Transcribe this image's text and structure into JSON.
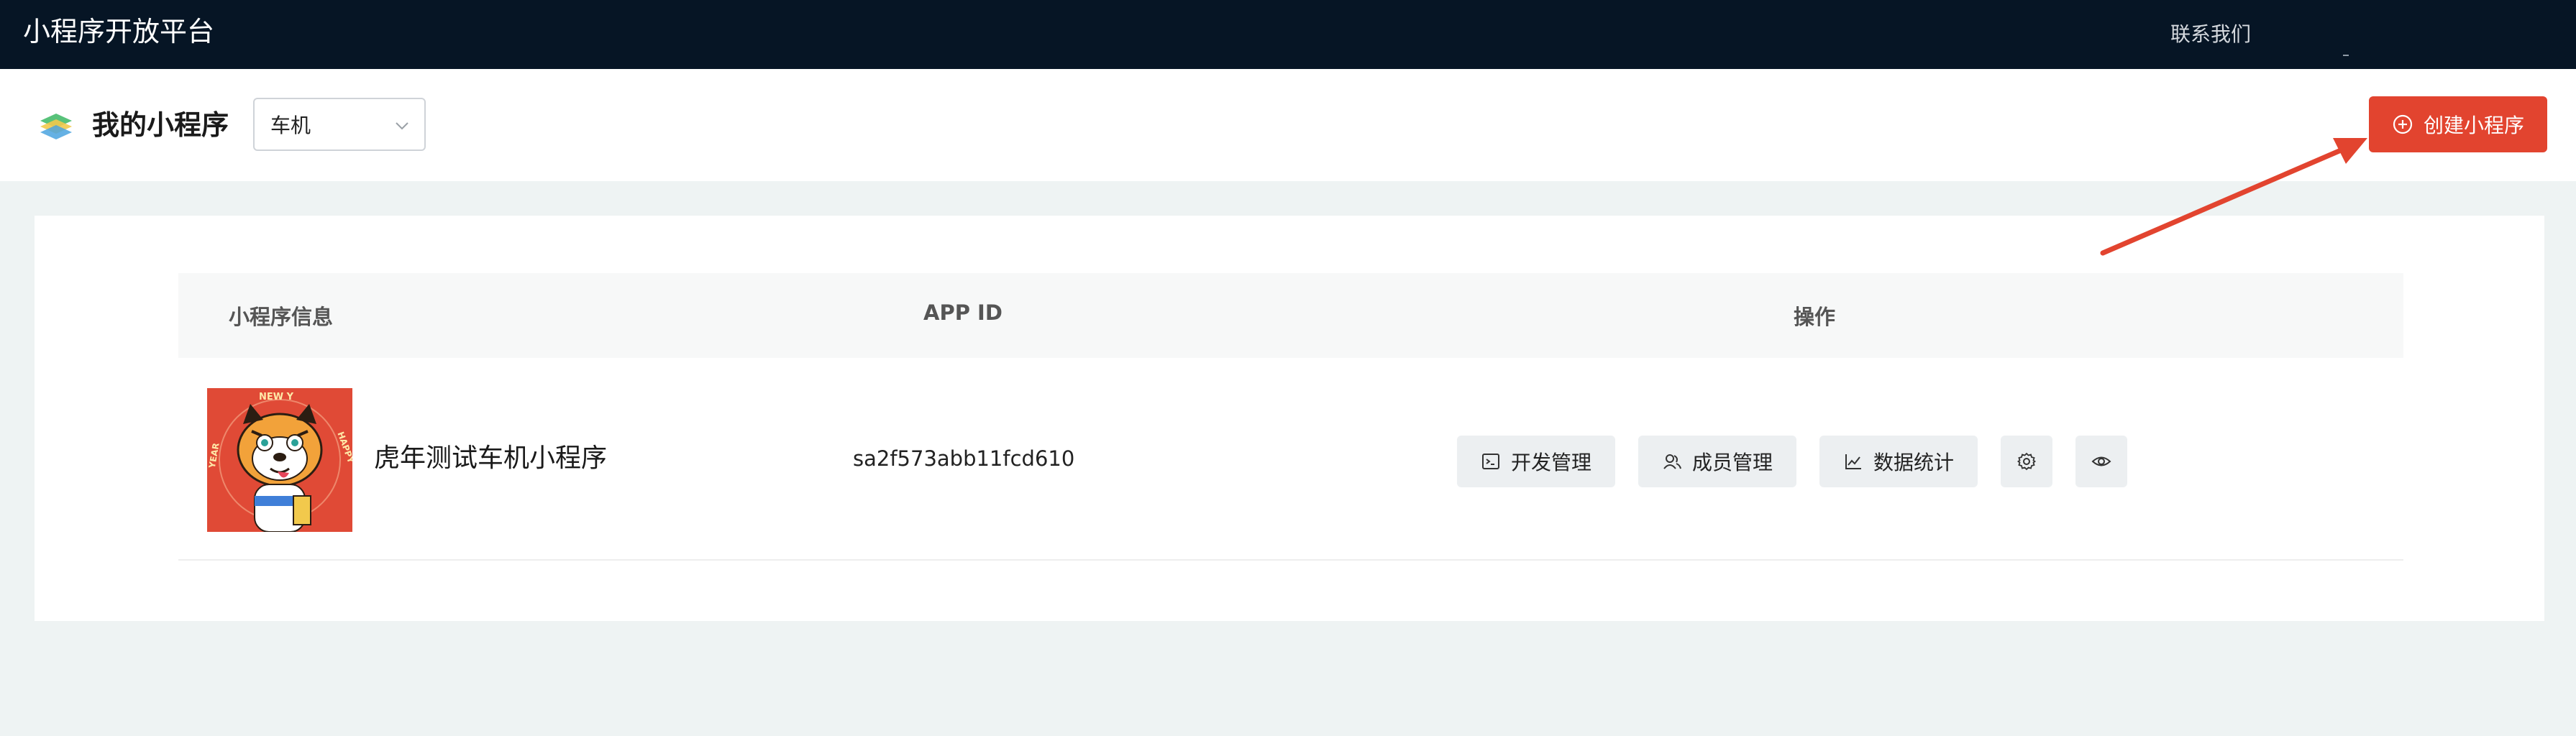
{
  "topbar": {
    "brand": "小程序开放平台",
    "contact": "联系我们"
  },
  "header": {
    "title": "我的小程序",
    "select_value": "车机",
    "create_button": "创建小程序"
  },
  "table": {
    "columns": [
      "小程序信息",
      "APP ID",
      "操作"
    ],
    "rows": [
      {
        "name": "虎年测试车机小程序",
        "app_id": "sa2f573abb11fcd610",
        "actions": {
          "dev": "开发管理",
          "member": "成员管理",
          "stats": "数据统计"
        }
      }
    ]
  },
  "thumbnail_text": {
    "arc_top": "NEW Y",
    "arc_left": "YEAR",
    "arc_right": "HAPPY"
  },
  "colors": {
    "topbar_bg": "#061525",
    "accent_red": "#e2442f",
    "page_bg": "#eef3f3"
  },
  "icons": [
    "logo-icon",
    "chevron-down-icon",
    "plus-circle-icon",
    "terminal-icon",
    "members-icon",
    "chart-line-icon",
    "gear-icon",
    "eye-icon"
  ]
}
